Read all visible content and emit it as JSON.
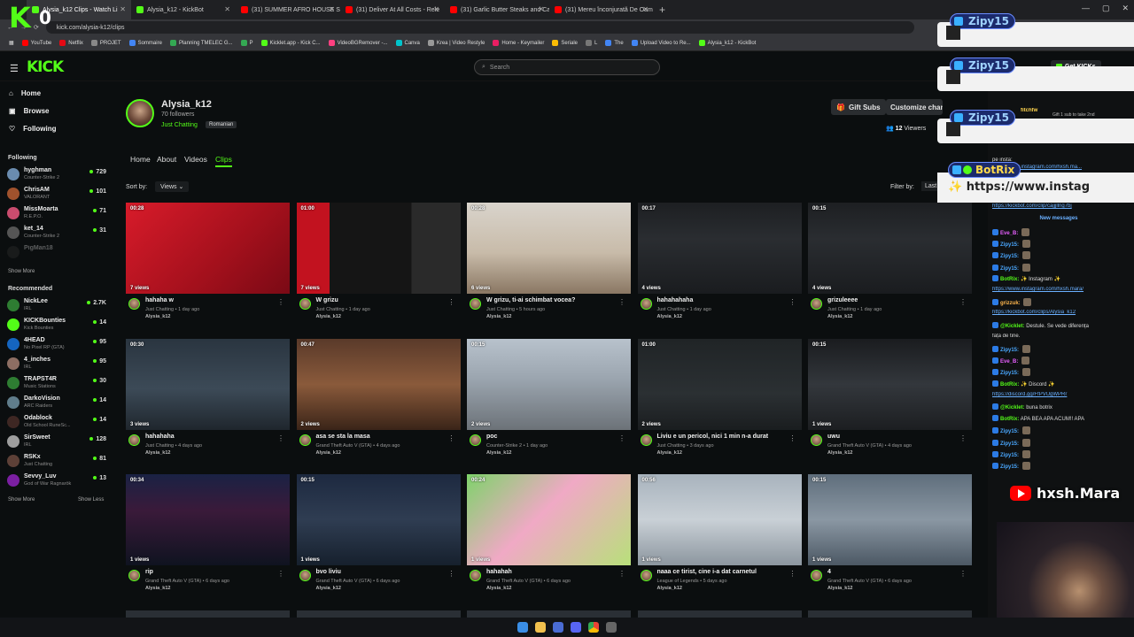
{
  "browser": {
    "tabs": [
      {
        "label": "Alysia_k12 Clips - Watch Li",
        "color": "#53fc18",
        "active": true
      },
      {
        "label": "Alysia_k12 - KickBot",
        "color": "#53fc18",
        "active": false
      },
      {
        "label": "(31) SUMMER AFRO HOUSE Su",
        "color": "#ff0000",
        "active": false
      },
      {
        "label": "(31) Deliver At All Costs - Rele",
        "color": "#ff0000",
        "active": false
      },
      {
        "label": "(31) Garlic Butter Steaks and Ca",
        "color": "#ff0000",
        "active": false
      },
      {
        "label": "(31) Mereu înconjurată De Oam",
        "color": "#ff0000",
        "active": false
      }
    ],
    "new_tab": "+",
    "url": "kick.com/alysia-k12/clips",
    "bookmarks": [
      {
        "label": "YouTube",
        "color": "#ff0000"
      },
      {
        "label": "Netflix",
        "color": "#e50914"
      },
      {
        "label": "PROJET",
        "color": "#888888"
      },
      {
        "label": "Sommaire",
        "color": "#4285f4"
      },
      {
        "label": "Planning TMELEC G...",
        "color": "#34a853"
      },
      {
        "label": "P",
        "color": "#34a853"
      },
      {
        "label": "Kicklet.app - Kick C...",
        "color": "#53fc18"
      },
      {
        "label": "VideoBGRemover -...",
        "color": "#ff4081"
      },
      {
        "label": "Canva",
        "color": "#00c4cc"
      },
      {
        "label": "Krea | Video Restyle",
        "color": "#999999"
      },
      {
        "label": "Home - Keymailer",
        "color": "#e91e63"
      },
      {
        "label": "Seriale",
        "color": "#fbbc05"
      },
      {
        "label": "L",
        "color": "#777777"
      },
      {
        "label": "The",
        "color": "#4285f4"
      },
      {
        "label": "Upload Video to Re...",
        "color": "#4285f4"
      },
      {
        "label": "Alysia_k12 - KickBot",
        "color": "#53fc18"
      }
    ]
  },
  "overlay": {
    "k": "K",
    "count": "0"
  },
  "kick": {
    "logo": "KICK",
    "search_placeholder": "Search",
    "get_kicks": "Get KICKs"
  },
  "sidebar": {
    "nav": [
      {
        "label": "Home",
        "icon": "home-icon"
      },
      {
        "label": "Browse",
        "icon": "browse-icon"
      },
      {
        "label": "Following",
        "icon": "heart-icon"
      }
    ],
    "following_header": "Following",
    "following": [
      {
        "name": "hyghman",
        "category": "Counter-Strike 2",
        "viewers": "729",
        "color": "#6a8caf"
      },
      {
        "name": "ChrisAM",
        "category": "VALORANT",
        "viewers": "101",
        "color": "#a0522d"
      },
      {
        "name": "MissMoarta",
        "category": "R.E.P.O.",
        "viewers": "71",
        "color": "#c94c6e"
      },
      {
        "name": "ket_14",
        "category": "Counter-Strike 2",
        "viewers": "31",
        "color": "#555555"
      },
      {
        "name": "PigMan18",
        "category": "",
        "viewers": "",
        "color": "#333333"
      }
    ],
    "show_more_1": "Show More",
    "recommended_header": "Recommended",
    "recommended": [
      {
        "name": "NickLee",
        "category": "IRL",
        "viewers": "2.7K",
        "color": "#2e7d32"
      },
      {
        "name": "KICKBounties",
        "category": "Kick Bounties",
        "viewers": "14",
        "color": "#53fc18"
      },
      {
        "name": "4HEAD",
        "category": "No Pixel RP (GTA)",
        "viewers": "95",
        "color": "#1565c0"
      },
      {
        "name": "4_inches",
        "category": "IRL",
        "viewers": "95",
        "color": "#8d6e63"
      },
      {
        "name": "TRAPST4R",
        "category": "Music Stations",
        "viewers": "30",
        "color": "#2e7d32"
      },
      {
        "name": "DarkoVision",
        "category": "ARC Raiders",
        "viewers": "14",
        "color": "#607d8b"
      },
      {
        "name": "Odablock",
        "category": "Old School RuneSc...",
        "viewers": "14",
        "color": "#3e2723"
      },
      {
        "name": "SirSweet",
        "category": "IRL",
        "viewers": "128",
        "color": "#9e9e9e"
      },
      {
        "name": "RSKx",
        "category": "Just Chatting",
        "viewers": "81",
        "color": "#5d4037"
      },
      {
        "name": "Sevvy_Luv",
        "category": "God of War Ragnarök",
        "viewers": "13",
        "color": "#7b1fa2"
      }
    ],
    "show_more_2": "Show More",
    "show_less": "Show Less"
  },
  "channel": {
    "name": "Alysia_k12",
    "followers": "70 followers",
    "category": "Just Chatting",
    "language": "Romanian",
    "gift_subs": "Gift Subs",
    "customize": "Customize channel",
    "viewers_count": "12",
    "viewers_label": "Viewers",
    "tabs": [
      "Home",
      "About",
      "Videos",
      "Clips"
    ],
    "active_tab": "Clips",
    "sort_label": "Sort by:",
    "sort_value": "Views",
    "filter_label": "Filter by:",
    "filter_value": "Last"
  },
  "clips": [
    {
      "duration": "00:28",
      "views": "7 views",
      "title": "hahaha w",
      "category": "Just Chatting",
      "age": "1 day ago",
      "user": "Alysia_k12",
      "thumb": "red"
    },
    {
      "duration": "01:00",
      "views": "7 views",
      "title": "W grizu",
      "category": "Just Chatting",
      "age": "1 day ago",
      "user": "Alysia_k12",
      "thumb": "redscreen"
    },
    {
      "duration": "00:28",
      "views": "6 views",
      "title": "W grizu, ti-ai schimbat vocea?",
      "category": "Just Chatting",
      "age": "5 hours ago",
      "user": "Alysia_k12",
      "thumb": "room"
    },
    {
      "duration": "00:17",
      "views": "4 views",
      "title": "hahahahaha",
      "category": "Just Chatting",
      "age": "1 day ago",
      "user": "Alysia_k12",
      "thumb": "dash"
    },
    {
      "duration": "00:15",
      "views": "4 views",
      "title": "grizuleeee",
      "category": "Just Chatting",
      "age": "1 day ago",
      "user": "Alysia_k12",
      "thumb": "dash"
    },
    {
      "duration": "00:30",
      "views": "3 views",
      "title": "hahahaha",
      "category": "Just Chatting",
      "age": "4 days ago",
      "user": "Alysia_k12",
      "thumb": "dark"
    },
    {
      "duration": "00:47",
      "views": "2 views",
      "title": "asa se sta la masa",
      "category": "Grand Theft Auto V (GTA)",
      "age": "4 days ago",
      "user": "Alysia_k12",
      "thumb": "bar"
    },
    {
      "duration": "00:15",
      "views": "2 views",
      "title": "poc",
      "category": "Counter-Strike 2",
      "age": "1 day ago",
      "user": "Alysia_k12",
      "thumb": "snowroad"
    },
    {
      "duration": "01:00",
      "views": "2 views",
      "title": "Liviu e un pericol, nici 1 min n-a durat",
      "category": "Just Chatting",
      "age": "3 days ago",
      "user": "Alysia_k12",
      "thumb": "inventory"
    },
    {
      "duration": "00:15",
      "views": "1 views",
      "title": "uwu",
      "category": "Grand Theft Auto V (GTA)",
      "age": "4 days ago",
      "user": "Alysia_k12",
      "thumb": "dash2"
    },
    {
      "duration": "00:34",
      "views": "1 views",
      "title": "rip",
      "category": "Grand Theft Auto V (GTA)",
      "age": "6 days ago",
      "user": "Alysia_k12",
      "thumb": "neon"
    },
    {
      "duration": "00:15",
      "views": "1 views",
      "title": "bvo liviu",
      "category": "Grand Theft Auto V (GTA)",
      "age": "6 days ago",
      "user": "Alysia_k12",
      "thumb": "nightroad"
    },
    {
      "duration": "00:24",
      "views": "1 views",
      "title": "hahahah",
      "category": "Grand Theft Auto V (GTA)",
      "age": "6 days ago",
      "user": "Alysia_k12",
      "thumb": "house"
    },
    {
      "duration": "00:56",
      "views": "1 views",
      "title": "naaa ce tirist, cine i-a dat carnetul",
      "category": "League of Legends",
      "age": "5 days ago",
      "user": "Alysia_k12",
      "thumb": "snow"
    },
    {
      "duration": "00:15",
      "views": "1 views",
      "title": "4",
      "category": "Grand Theft Auto V (GTA)",
      "age": "6 days ago",
      "user": "Alysia_k12",
      "thumb": "snow2"
    }
  ],
  "chat": {
    "partial_top_a": "pe insta:",
    "partial_top_b": "https://www.instagram.com/hxsh.ma...",
    "partial_user": "fitchfw",
    "partial_note": "Gift 1 sub to take 2nd",
    "link_top": "https://kickbot.com/clip/cajjjllng7bj",
    "new_messages": "New messages",
    "messages": [
      {
        "user": "Eve_B:",
        "color": "#e85fff",
        "text": "",
        "link": false
      },
      {
        "user": "Zipy15:",
        "color": "#4aa8ff",
        "text": "",
        "link": false
      },
      {
        "user": "Zipy15:",
        "color": "#4aa8ff",
        "text": "",
        "link": false
      },
      {
        "user": "Zipy15:",
        "color": "#4aa8ff",
        "text": "",
        "link": false
      },
      {
        "user": "BotRix:",
        "color": "#53fc18",
        "text": "✨ Instagram ✨",
        "link": false
      },
      {
        "user": "",
        "color": "",
        "text": "https://www.instagram.com/hxsh.mara/",
        "link": true
      },
      {
        "user": "grizzuk:",
        "color": "#ffb74d",
        "text": "",
        "link": false
      },
      {
        "user": "",
        "color": "",
        "text": "https://kickbot.com/clips/Alysia_k12",
        "link": true
      },
      {
        "user": "@Kicklet:",
        "color": "#53fc18",
        "text": "Destule. Se vede diferența",
        "link": false
      },
      {
        "user": "",
        "color": "",
        "text": "fața de tine.",
        "link": false
      },
      {
        "user": "Zipy15:",
        "color": "#4aa8ff",
        "text": "",
        "link": false
      },
      {
        "user": "Eve_B:",
        "color": "#e85fff",
        "text": "",
        "link": false
      },
      {
        "user": "Zipy15:",
        "color": "#4aa8ff",
        "text": "",
        "link": false
      },
      {
        "user": "BotRix:",
        "color": "#53fc18",
        "text": "✨ Discord ✨",
        "link": false
      },
      {
        "user": "",
        "color": "",
        "text": "https://discord.gg/FfPVUgWPRr",
        "link": true
      },
      {
        "user": "@Kicklet:",
        "color": "#53fc18",
        "text": "buna botrix",
        "link": false
      },
      {
        "user": "BotRix:",
        "color": "#53fc18",
        "text": "APA BEA APA ACUM!! APA",
        "link": false
      },
      {
        "user": "Zipy15:",
        "color": "#4aa8ff",
        "text": "",
        "link": false
      },
      {
        "user": "Zipy15:",
        "color": "#4aa8ff",
        "text": "",
        "link": false
      },
      {
        "user": "Zipy15:",
        "color": "#4aa8ff",
        "text": "",
        "link": false
      },
      {
        "user": "Zipy15:",
        "color": "#4aa8ff",
        "text": "",
        "link": false
      }
    ]
  },
  "stream_overlay": {
    "notifications": [
      {
        "user": "Zipy15"
      },
      {
        "user": "Zipy15"
      },
      {
        "user": "Zipy15"
      }
    ],
    "botrix_user": "BotRix",
    "botrix_message": "✨ https://www.instag",
    "youtube_handle": "hxsh.Mara"
  }
}
